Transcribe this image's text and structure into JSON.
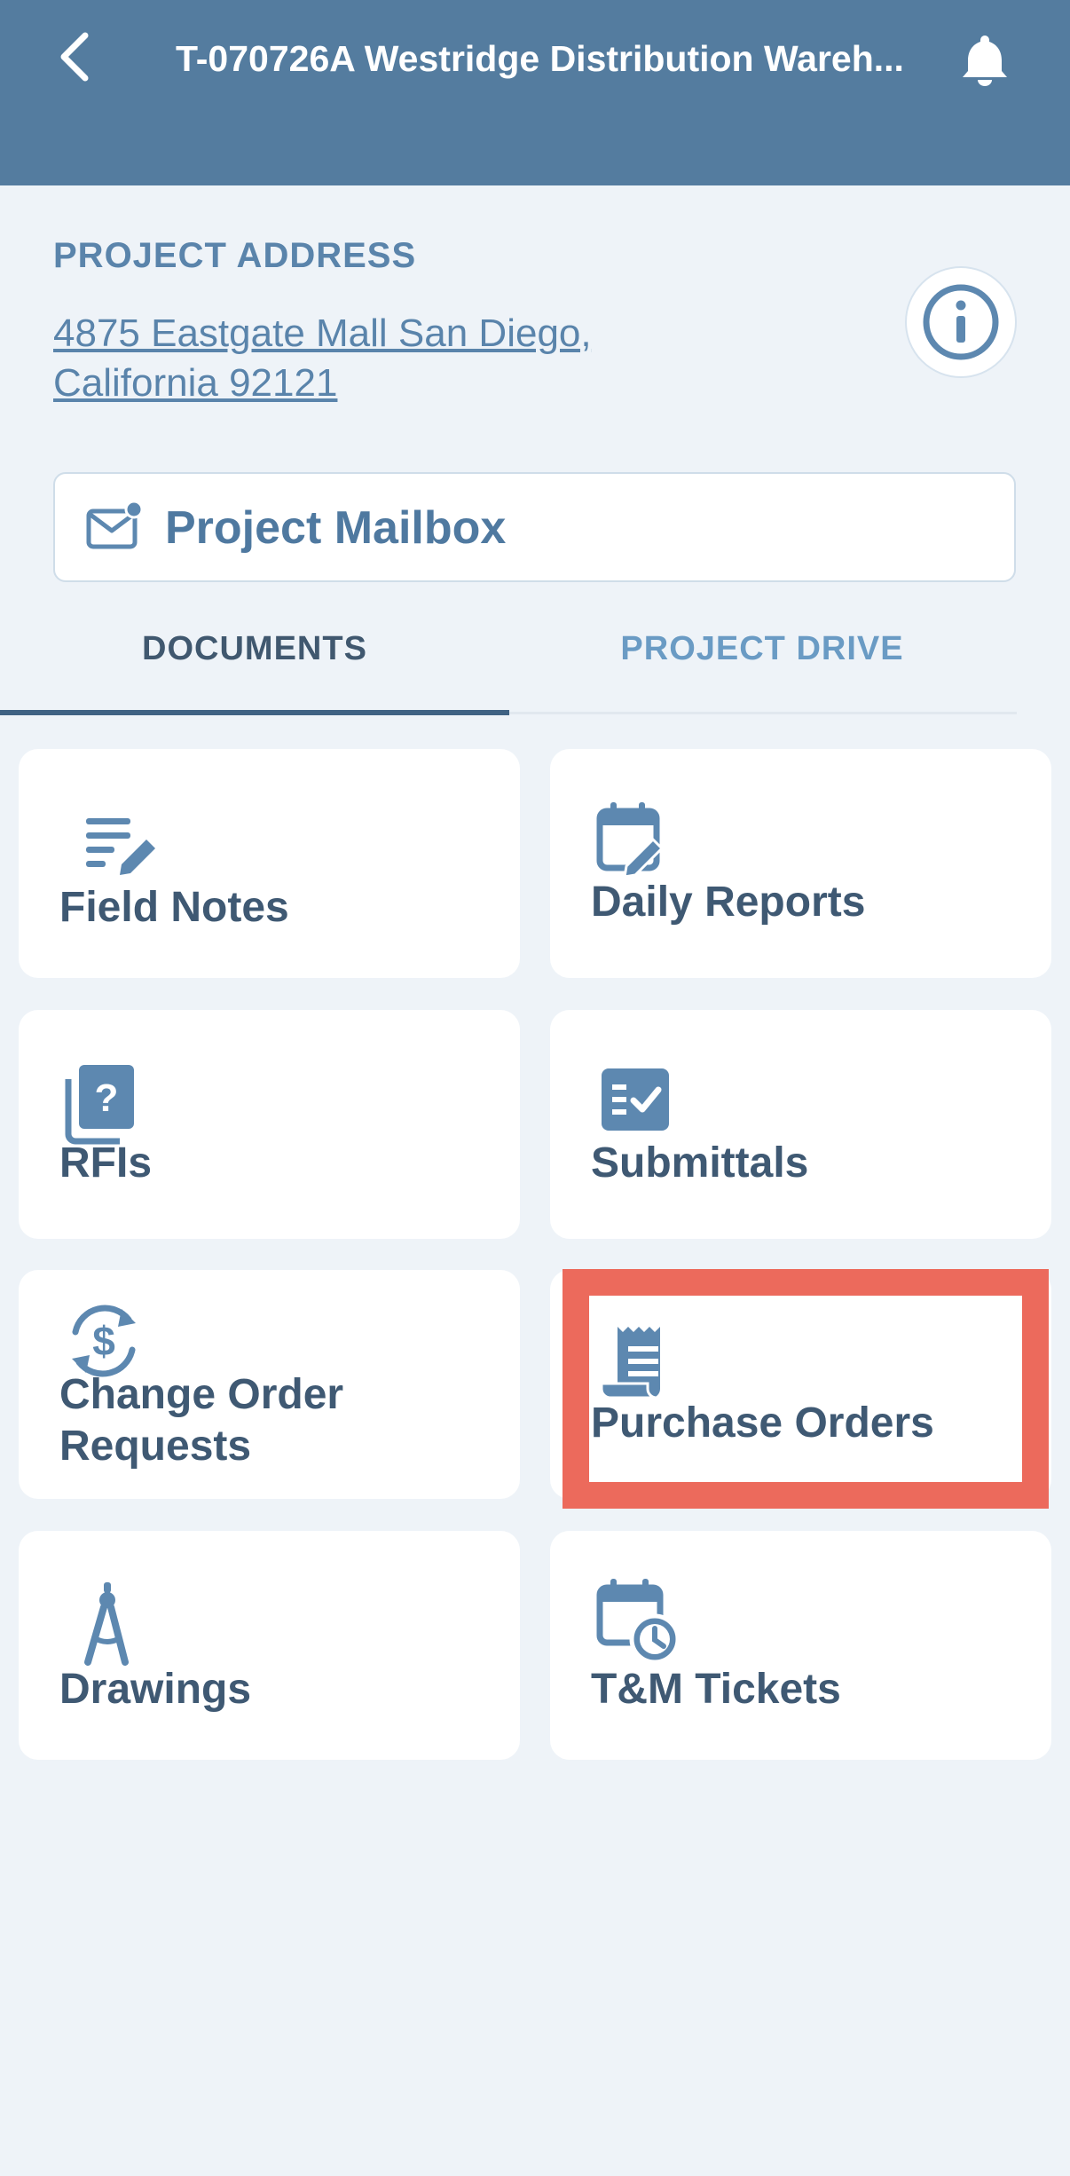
{
  "header": {
    "title": "T-070726A Westridge Distribution Wareh...",
    "back_icon": "chevron-left-icon",
    "bell_icon": "bell-icon",
    "background": "#547c9f"
  },
  "project": {
    "address_label": "PROJECT ADDRESS",
    "address_line1": "4875 Eastgate Mall  San Diego,",
    "address_line2": "California 92121",
    "info_icon": "info-icon"
  },
  "mailbox": {
    "label": "Project Mailbox",
    "icon": "mail-notification-icon"
  },
  "tabs": [
    {
      "label": "DOCUMENTS",
      "active": true
    },
    {
      "label": "PROJECT DRIVE",
      "active": false
    }
  ],
  "tiles": [
    {
      "label": "Field Notes",
      "icon": "field-notes-icon"
    },
    {
      "label": "Daily Reports",
      "icon": "calendar-edit-icon"
    },
    {
      "label": "RFIs",
      "icon": "question-document-icon"
    },
    {
      "label": "Submittals",
      "icon": "checklist-icon"
    },
    {
      "label_line1": "Change Order",
      "label_line2": "Requests",
      "icon": "dollar-cycle-icon"
    },
    {
      "label": "Purchase Orders",
      "icon": "receipt-icon"
    },
    {
      "label": "Drawings",
      "icon": "drafting-compass-icon"
    },
    {
      "label": "T&M Tickets",
      "icon": "calendar-clock-icon"
    }
  ],
  "colors": {
    "accent": "#547c9f",
    "icon": "#5d88b0",
    "text": "#3f5973",
    "highlight": "#ec6a5c"
  }
}
